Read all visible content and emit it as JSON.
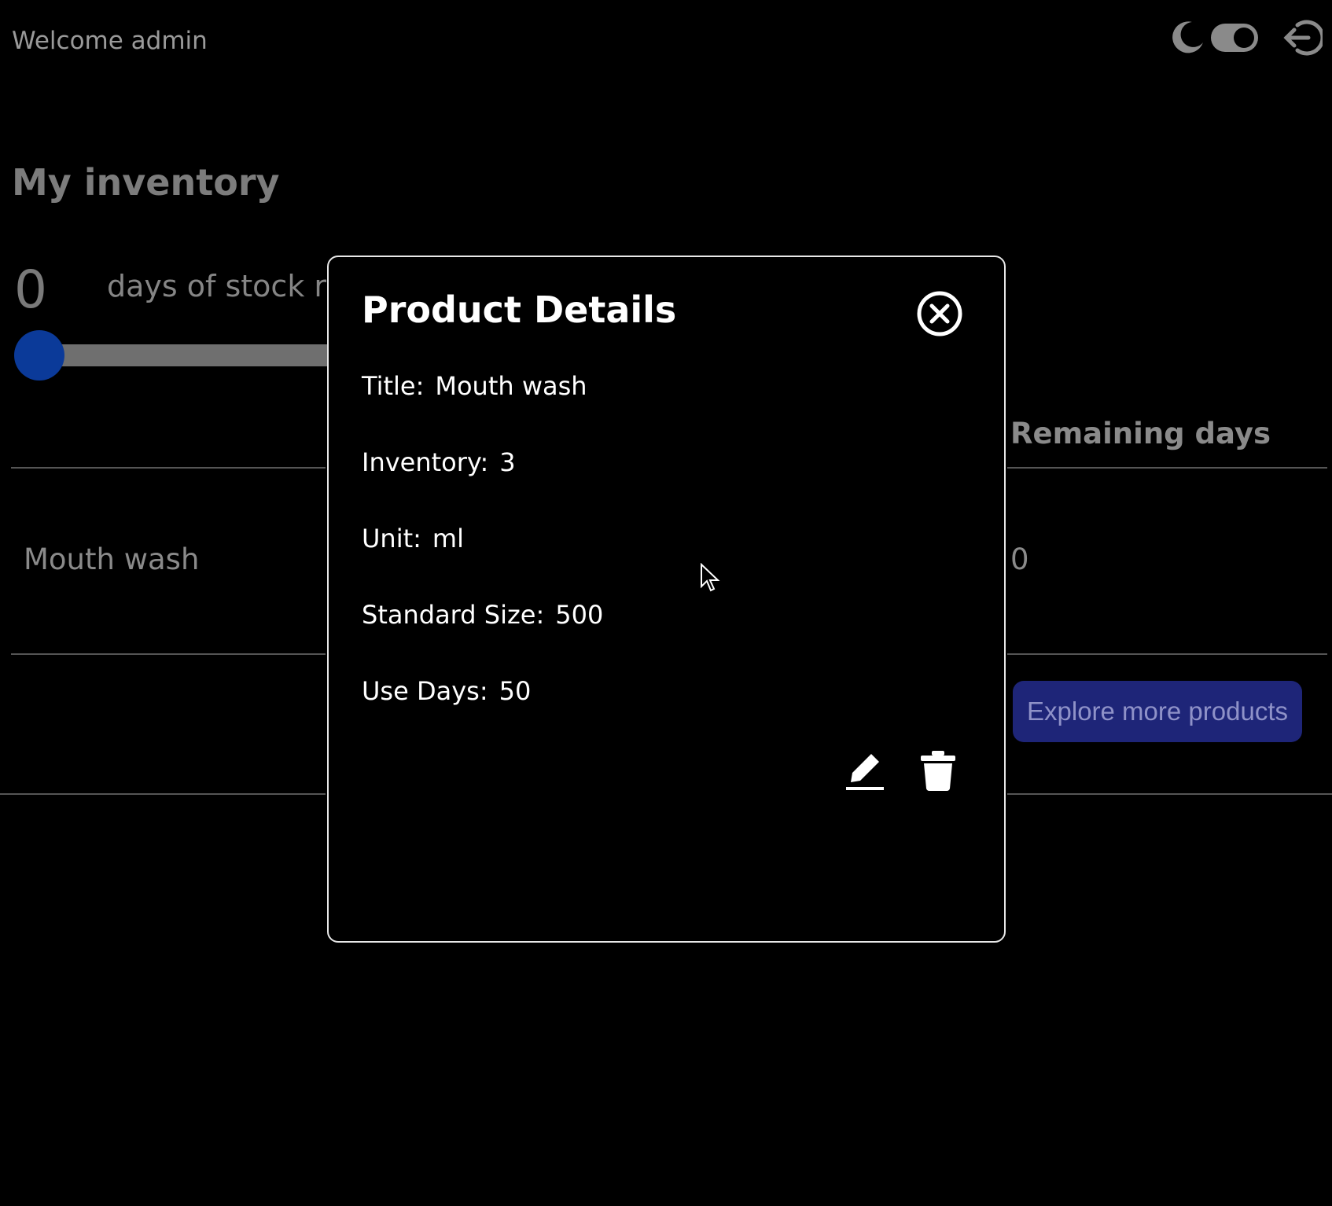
{
  "header": {
    "welcome_text": "Welcome admin",
    "icons": [
      "moon-icon",
      "toggle-switch-icon",
      "logout-icon"
    ]
  },
  "inventory": {
    "title": "My inventory",
    "days_value": "0",
    "days_label": "days of stock re",
    "slider_value": 0,
    "table": {
      "columns": [
        "Remaining days"
      ],
      "rows": [
        {
          "title": "Mouth wash",
          "remaining": "0"
        }
      ]
    },
    "explore_button": "Explore more products"
  },
  "modal": {
    "title": "Product Details",
    "fields": [
      {
        "label": "Title:",
        "value": "Mouth wash"
      },
      {
        "label": "Inventory:",
        "value": "3"
      },
      {
        "label": "Unit:",
        "value": "ml"
      },
      {
        "label": "Standard Size:",
        "value": "500"
      },
      {
        "label": "Use Days:",
        "value": "50"
      }
    ],
    "icons": [
      "close-circle-icon",
      "edit-pencil-icon",
      "trash-icon"
    ]
  },
  "colors": {
    "background": "#000000",
    "accent_blue": "#0b3a99",
    "explore_bg": "#1e2578",
    "modal_border": "#e8e8e8"
  }
}
